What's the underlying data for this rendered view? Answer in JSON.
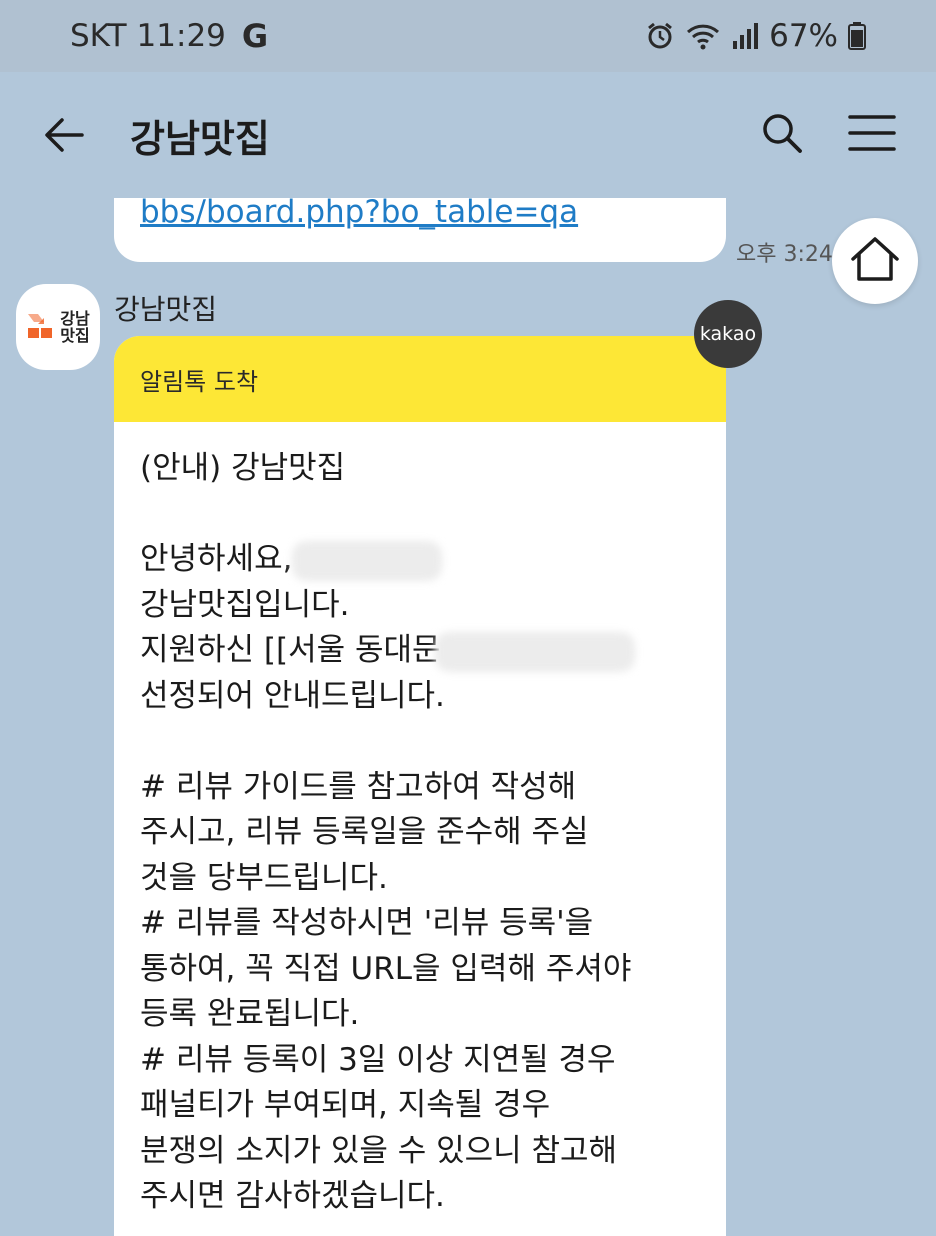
{
  "status_bar": {
    "carrier": "SKT",
    "time": "11:29",
    "g_logo": "G",
    "battery_percent": "67%",
    "icons": [
      "alarm-icon",
      "wifi-icon",
      "signal-icon",
      "battery-icon"
    ]
  },
  "header": {
    "title": "강남맛집",
    "icons": [
      "back-arrow-icon",
      "search-icon",
      "menu-icon"
    ]
  },
  "previous_message": {
    "link_text": "bbs/board.php?bo_table=qa",
    "time": "오후 3:24"
  },
  "home_button": {
    "icon": "home-icon"
  },
  "message": {
    "sender": "강남맛집",
    "avatar_text": [
      "강남",
      "맛집"
    ],
    "badge": "kakao",
    "card_header": "알림톡 도착",
    "lines": [
      "(안내) 강남맛집",
      "",
      "안녕하세요,",
      "강남맛집입니다.",
      "지원하신 [[서울 동대문",
      "선정되어 안내드립니다.",
      "",
      "# 리뷰 가이드를 참고하여 작성해",
      "주시고, 리뷰 등록일을 준수해 주실",
      "것을 당부드립니다.",
      "# 리뷰를 작성하시면 '리뷰 등록'을",
      "통하여, 꼭 직접 URL을 입력해 주셔야",
      "등록 완료됩니다.",
      "# 리뷰 등록이 3일 이상 지연될 경우",
      "패널티가 부여되며, 지속될 경우",
      "분쟁의 소지가 있을 수 있으니 참고해",
      "주시면 감사하겠습니다."
    ]
  },
  "colors": {
    "chat_background": "#b2c7da",
    "alimtalk_yellow": "#fde736",
    "link_blue": "#1f7cc6",
    "badge_dark": "#3a3a3a",
    "logo_orange": "#f0652a"
  }
}
